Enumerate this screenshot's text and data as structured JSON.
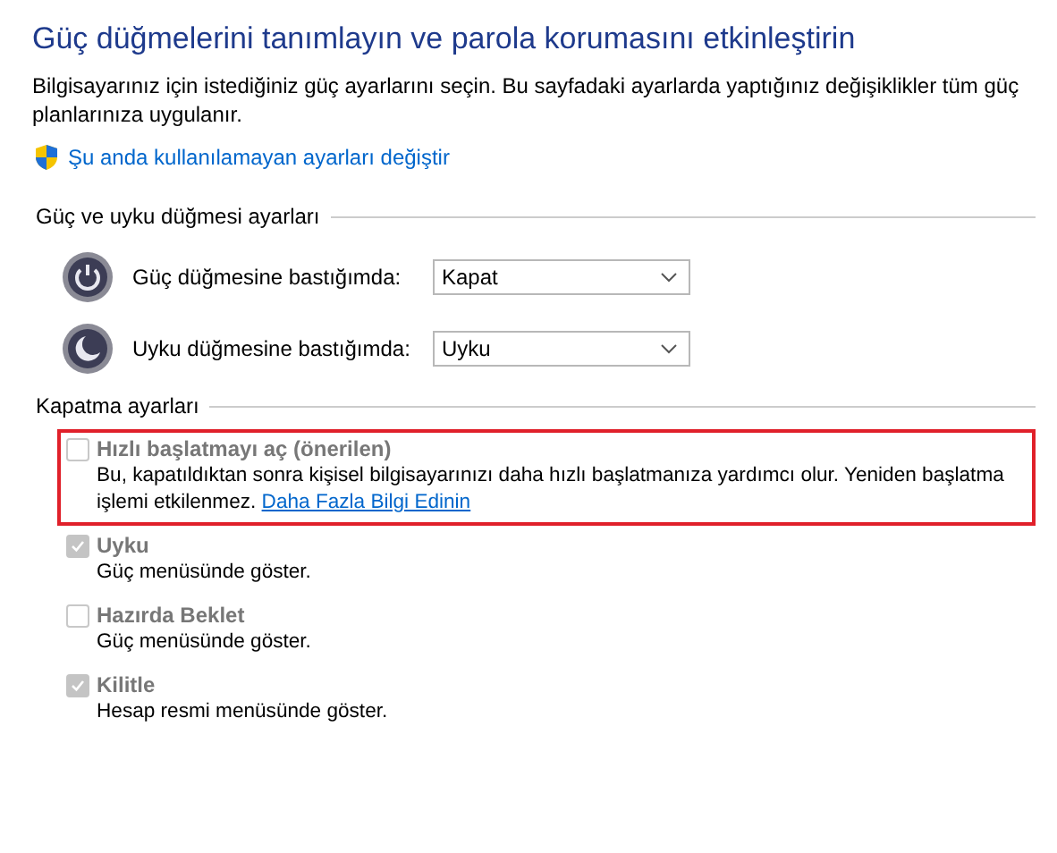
{
  "title": "Güç düğmelerini tanımlayın ve parola korumasını etkinleştirin",
  "description": "Bilgisayarınız için istediğiniz güç ayarlarını seçin. Bu sayfadaki ayarlarda yaptığınız değişiklikler tüm güç planlarınıza uygulanır.",
  "admin_link": "Şu anda kullanılamayan ayarları değiştir",
  "button_settings": {
    "heading": "Güç ve uyku düğmesi ayarları",
    "rows": [
      {
        "kind": "power",
        "label": "Güç düğmesine bastığımda:",
        "value": "Kapat"
      },
      {
        "kind": "sleep",
        "label": "Uyku düğmesine bastığımda:",
        "value": "Uyku"
      }
    ]
  },
  "shutdown_settings": {
    "heading": "Kapatma ayarları",
    "options": [
      {
        "label": "Hızlı başlatmayı aç (önerilen)",
        "checked": false,
        "disabled": true,
        "highlighted": true,
        "description": "Bu, kapatıldıktan sonra kişisel bilgisayarınızı daha hızlı başlatmanıza yardımcı olur. Yeniden başlatma işlemi etkilenmez.",
        "link": "Daha Fazla Bilgi Edinin"
      },
      {
        "label": "Uyku",
        "checked": true,
        "disabled": true,
        "highlighted": false,
        "description": "Güç menüsünde göster."
      },
      {
        "label": "Hazırda Beklet",
        "checked": false,
        "disabled": true,
        "highlighted": false,
        "description": "Güç menüsünde göster."
      },
      {
        "label": "Kilitle",
        "checked": true,
        "disabled": true,
        "highlighted": false,
        "description": "Hesap resmi menüsünde göster."
      }
    ]
  }
}
